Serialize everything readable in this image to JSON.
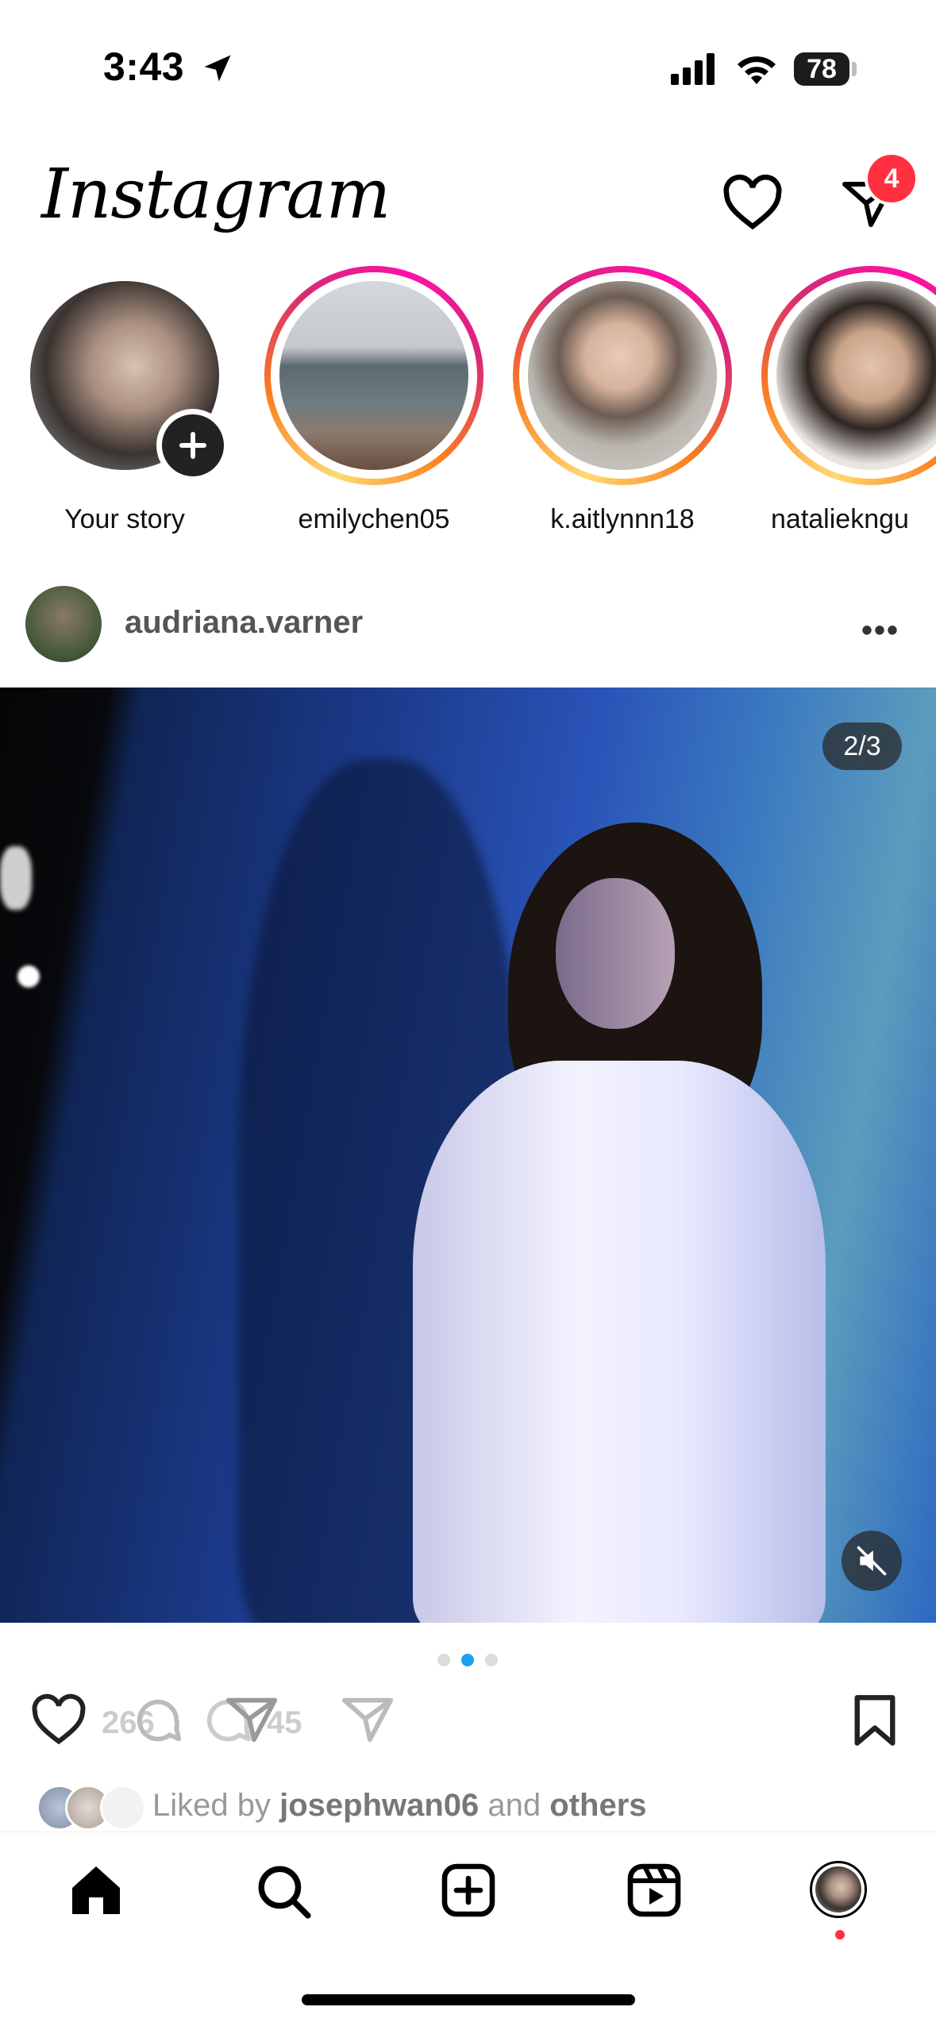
{
  "status_bar": {
    "time": "3:43",
    "battery": "78"
  },
  "header": {
    "logo": "Instagram",
    "dm_badge": "4"
  },
  "stories": [
    {
      "label": "Your story"
    },
    {
      "label": "emilychen05"
    },
    {
      "label": "k.aitlynnn18"
    },
    {
      "label": "nataliekngu"
    }
  ],
  "post": {
    "username": "audriana.varner",
    "more": "•••",
    "counter": "2/3",
    "likes_count": "266",
    "shares_count": "45",
    "liked_by_prefix": "Liked by ",
    "liked_by_user": "josephwan06",
    "liked_by_middle": " and ",
    "liked_by_others": "others"
  },
  "colors": {
    "notification_red": "#ff3040",
    "active_dot": "#1da1f2"
  },
  "icons": [
    "location-arrow-icon",
    "signal-icon",
    "wifi-icon",
    "heart-icon",
    "direct-message-icon",
    "add-story-icon",
    "more-icon",
    "mute-icon",
    "like-icon",
    "comment-icon",
    "share-icon",
    "bookmark-icon",
    "home-icon",
    "search-icon",
    "create-icon",
    "reels-icon",
    "profile-icon"
  ]
}
